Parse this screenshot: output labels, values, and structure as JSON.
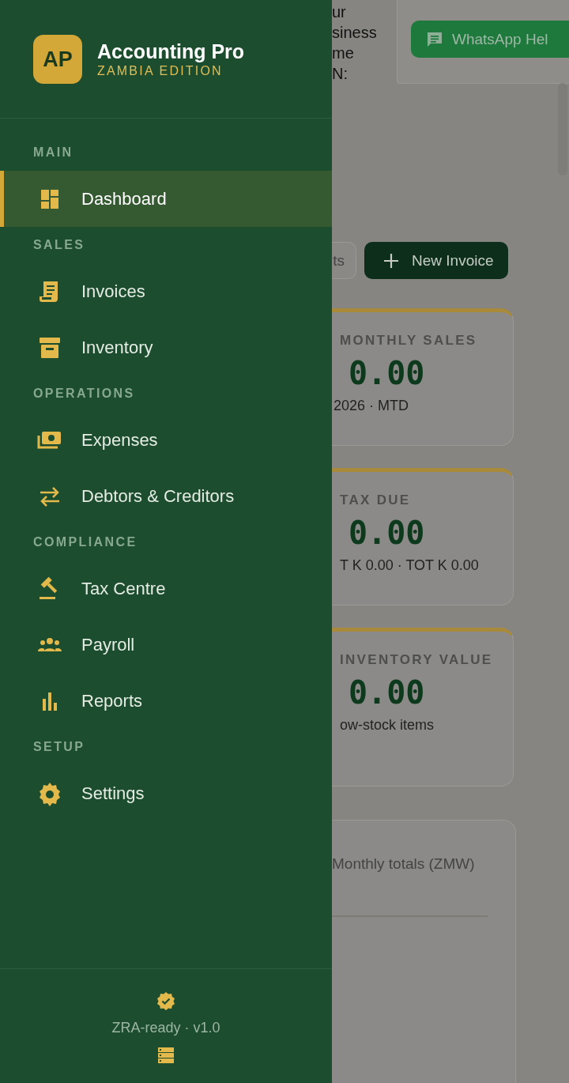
{
  "background_page": {
    "header_lines": [
      "ur",
      "siness",
      "me",
      "N:"
    ],
    "whatsapp_button": "WhatsApp Hel",
    "actions": [
      {
        "label": "ts",
        "kind": "outline"
      },
      {
        "label": "New Invoice",
        "kind": "primary"
      }
    ],
    "stat_cards": [
      {
        "label": "MONTHLY SALES",
        "value": "0.00",
        "note": "2026 · MTD"
      },
      {
        "label": "TAX DUE",
        "value": "0.00",
        "note": "T K 0.00 · TOT K 0.00"
      },
      {
        "label": "INVENTORY VALUE",
        "value": "0.00",
        "note": "ow-stock items"
      }
    ],
    "chart_card": {
      "subtitle": "Monthly totals (ZMW)"
    }
  },
  "drawer": {
    "logo": "AP",
    "title": "Accounting Pro",
    "subtitle": "ZAMBIA EDITION",
    "sections": [
      {
        "label": "MAIN",
        "items": [
          {
            "label": "Dashboard",
            "selected": true
          }
        ]
      },
      {
        "label": "SALES",
        "items": [
          {
            "label": "Invoices",
            "selected": false
          },
          {
            "label": "Inventory",
            "selected": false
          }
        ]
      },
      {
        "label": "OPERATIONS",
        "items": [
          {
            "label": "Expenses",
            "selected": false
          },
          {
            "label": "Debtors & Creditors",
            "selected": false
          }
        ]
      },
      {
        "label": "COMPLIANCE",
        "items": [
          {
            "label": "Tax Centre",
            "selected": false
          },
          {
            "label": "Payroll",
            "selected": false
          },
          {
            "label": "Reports",
            "selected": false
          }
        ]
      },
      {
        "label": "SETUP",
        "items": [
          {
            "label": "Settings",
            "selected": false
          }
        ]
      }
    ],
    "footer": {
      "status": "ZRA-ready · v1.0"
    }
  }
}
